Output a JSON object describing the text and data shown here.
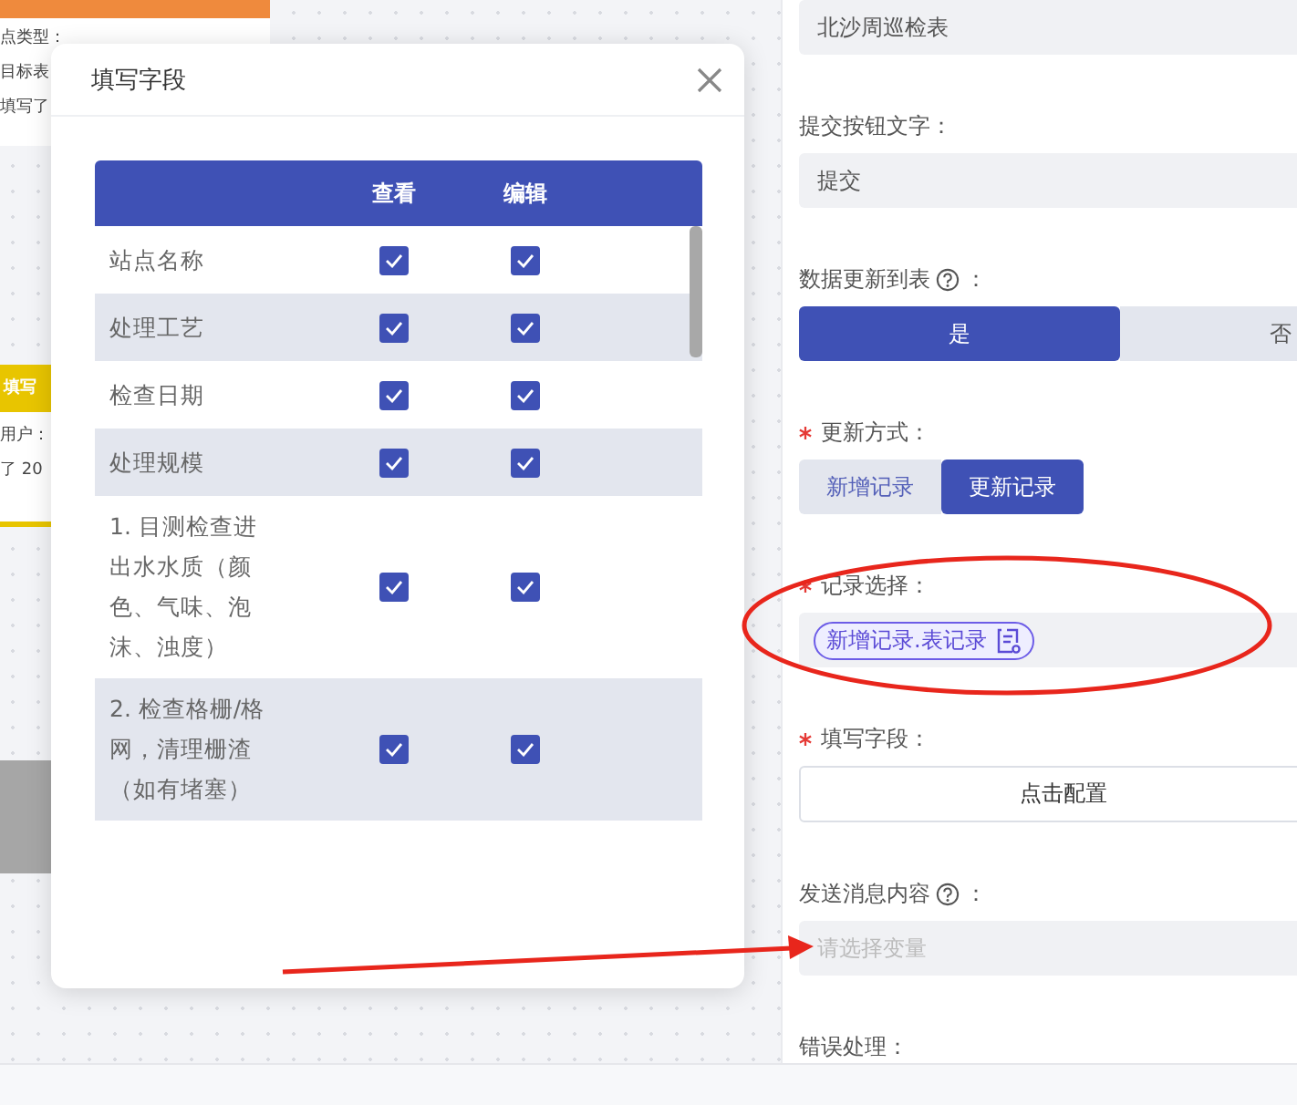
{
  "canvas": {
    "cards": [
      {
        "kind": "orange",
        "lines": [
          "点类型：",
          "目标表",
          "填写了"
        ]
      },
      {
        "kind": "yellow",
        "title": "填写",
        "lines": [
          "用户：",
          "了 20"
        ]
      }
    ]
  },
  "dialog": {
    "title": "填写字段",
    "columns": [
      "查看",
      "编辑"
    ],
    "rows": [
      {
        "name": "站点名称",
        "view": true,
        "edit": true
      },
      {
        "name": "处理工艺",
        "view": true,
        "edit": true
      },
      {
        "name": "检查日期",
        "view": true,
        "edit": true
      },
      {
        "name": "处理规模",
        "view": true,
        "edit": true
      },
      {
        "name": "1. 目测检查进出水水质（颜色、气味、泡沫、浊度）",
        "view": true,
        "edit": true
      },
      {
        "name": "2. 检查格栅/格网，清理栅渣（如有堵塞）",
        "view": true,
        "edit": true
      }
    ]
  },
  "form": {
    "fields": [
      {
        "kind": "input",
        "value": "北沙周巡检表"
      },
      {
        "kind": "input",
        "label": "提交按钮文字：",
        "value": "提交"
      },
      {
        "kind": "segmented",
        "label": "数据更新到表",
        "help": true,
        "suffix": "：",
        "stretch": true,
        "options": [
          {
            "label": "是",
            "selected": true
          },
          {
            "label": "否",
            "selected": false
          }
        ]
      },
      {
        "kind": "segmented",
        "label": "更新方式：",
        "required": true,
        "options": [
          {
            "label": "新增记录",
            "selected": false
          },
          {
            "label": "更新记录",
            "selected": true
          }
        ]
      },
      {
        "kind": "tags",
        "label": "记录选择：",
        "required": true,
        "tags": [
          "新增记录.表记录"
        ]
      },
      {
        "kind": "button",
        "label": "填写字段：",
        "required": true,
        "text": "点击配置"
      },
      {
        "kind": "input",
        "label": "发送消息内容",
        "help": true,
        "suffix": "：",
        "placeholder": "请选择变量"
      },
      {
        "kind": "label",
        "label": "错误处理："
      }
    ]
  }
}
